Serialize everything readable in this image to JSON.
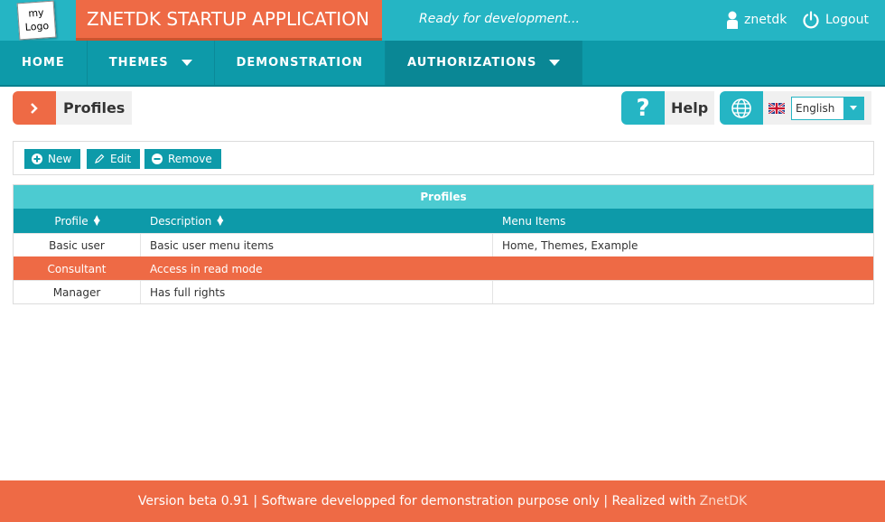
{
  "header": {
    "logo_line1": "my",
    "logo_line2": "Logo",
    "app_title": "ZNETDK STARTUP APPLICATION",
    "status": "Ready for development...",
    "user": "znetdk",
    "logout": "Logout"
  },
  "nav": {
    "items": [
      {
        "label": "HOME"
      },
      {
        "label": "THEMES"
      },
      {
        "label": "DEMONSTRATION"
      },
      {
        "label": "AUTHORIZATIONS"
      }
    ]
  },
  "breadcrumb": {
    "title": "Profiles"
  },
  "help": {
    "icon_glyph": "?",
    "label": "Help"
  },
  "language": {
    "selected": "English"
  },
  "toolbar": {
    "new_label": "New",
    "edit_label": "Edit",
    "remove_label": "Remove"
  },
  "table": {
    "caption": "Profiles",
    "columns": [
      "Profile",
      "Description",
      "Menu Items"
    ],
    "rows": [
      {
        "profile": "Basic user",
        "description": "Basic user menu items",
        "menu_items": "Home, Themes, Example"
      },
      {
        "profile": "Consultant",
        "description": "Access in read mode",
        "menu_items": ""
      },
      {
        "profile": "Manager",
        "description": "Has full rights",
        "menu_items": ""
      }
    ]
  },
  "footer": {
    "text": "Version beta 0.91 | Software developped for demonstration purpose only | Realized with",
    "link": "ZnetDK"
  },
  "colors": {
    "teal": "#25b5c4",
    "dark_teal": "#0d9aa9",
    "orange": "#ee6a45",
    "caption_teal": "#4ccbd1"
  },
  "icons": [
    "user-icon",
    "power-icon",
    "chevron-right-icon",
    "help-icon",
    "globe-icon",
    "uk-flag-icon",
    "plus-circle-icon",
    "pencil-icon",
    "minus-circle-icon",
    "sort-icon",
    "dropdown-arrow-icon"
  ]
}
